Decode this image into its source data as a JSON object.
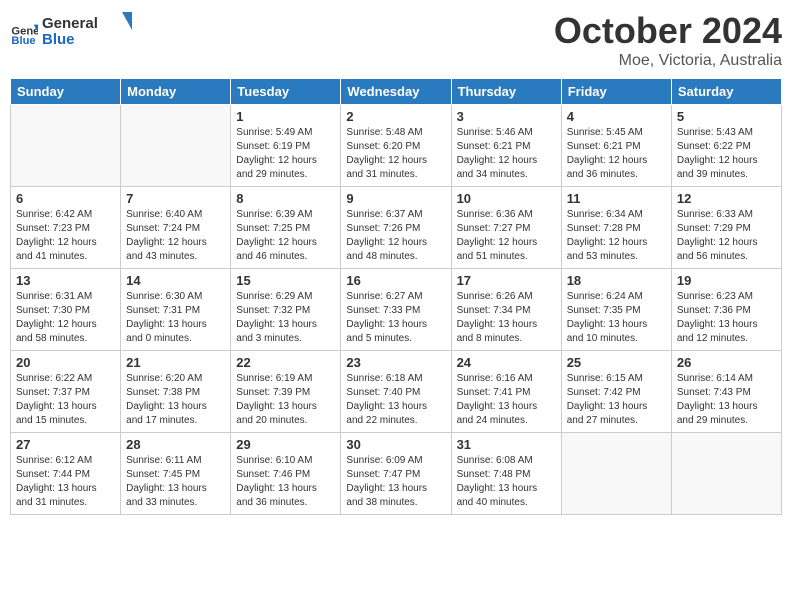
{
  "header": {
    "logo_line1": "General",
    "logo_line2": "Blue",
    "month_title": "October 2024",
    "subtitle": "Moe, Victoria, Australia"
  },
  "days_of_week": [
    "Sunday",
    "Monday",
    "Tuesday",
    "Wednesday",
    "Thursday",
    "Friday",
    "Saturday"
  ],
  "weeks": [
    [
      {
        "day": "",
        "info": ""
      },
      {
        "day": "",
        "info": ""
      },
      {
        "day": "1",
        "info": "Sunrise: 5:49 AM\nSunset: 6:19 PM\nDaylight: 12 hours\nand 29 minutes."
      },
      {
        "day": "2",
        "info": "Sunrise: 5:48 AM\nSunset: 6:20 PM\nDaylight: 12 hours\nand 31 minutes."
      },
      {
        "day": "3",
        "info": "Sunrise: 5:46 AM\nSunset: 6:21 PM\nDaylight: 12 hours\nand 34 minutes."
      },
      {
        "day": "4",
        "info": "Sunrise: 5:45 AM\nSunset: 6:21 PM\nDaylight: 12 hours\nand 36 minutes."
      },
      {
        "day": "5",
        "info": "Sunrise: 5:43 AM\nSunset: 6:22 PM\nDaylight: 12 hours\nand 39 minutes."
      }
    ],
    [
      {
        "day": "6",
        "info": "Sunrise: 6:42 AM\nSunset: 7:23 PM\nDaylight: 12 hours\nand 41 minutes."
      },
      {
        "day": "7",
        "info": "Sunrise: 6:40 AM\nSunset: 7:24 PM\nDaylight: 12 hours\nand 43 minutes."
      },
      {
        "day": "8",
        "info": "Sunrise: 6:39 AM\nSunset: 7:25 PM\nDaylight: 12 hours\nand 46 minutes."
      },
      {
        "day": "9",
        "info": "Sunrise: 6:37 AM\nSunset: 7:26 PM\nDaylight: 12 hours\nand 48 minutes."
      },
      {
        "day": "10",
        "info": "Sunrise: 6:36 AM\nSunset: 7:27 PM\nDaylight: 12 hours\nand 51 minutes."
      },
      {
        "day": "11",
        "info": "Sunrise: 6:34 AM\nSunset: 7:28 PM\nDaylight: 12 hours\nand 53 minutes."
      },
      {
        "day": "12",
        "info": "Sunrise: 6:33 AM\nSunset: 7:29 PM\nDaylight: 12 hours\nand 56 minutes."
      }
    ],
    [
      {
        "day": "13",
        "info": "Sunrise: 6:31 AM\nSunset: 7:30 PM\nDaylight: 12 hours\nand 58 minutes."
      },
      {
        "day": "14",
        "info": "Sunrise: 6:30 AM\nSunset: 7:31 PM\nDaylight: 13 hours\nand 0 minutes."
      },
      {
        "day": "15",
        "info": "Sunrise: 6:29 AM\nSunset: 7:32 PM\nDaylight: 13 hours\nand 3 minutes."
      },
      {
        "day": "16",
        "info": "Sunrise: 6:27 AM\nSunset: 7:33 PM\nDaylight: 13 hours\nand 5 minutes."
      },
      {
        "day": "17",
        "info": "Sunrise: 6:26 AM\nSunset: 7:34 PM\nDaylight: 13 hours\nand 8 minutes."
      },
      {
        "day": "18",
        "info": "Sunrise: 6:24 AM\nSunset: 7:35 PM\nDaylight: 13 hours\nand 10 minutes."
      },
      {
        "day": "19",
        "info": "Sunrise: 6:23 AM\nSunset: 7:36 PM\nDaylight: 13 hours\nand 12 minutes."
      }
    ],
    [
      {
        "day": "20",
        "info": "Sunrise: 6:22 AM\nSunset: 7:37 PM\nDaylight: 13 hours\nand 15 minutes."
      },
      {
        "day": "21",
        "info": "Sunrise: 6:20 AM\nSunset: 7:38 PM\nDaylight: 13 hours\nand 17 minutes."
      },
      {
        "day": "22",
        "info": "Sunrise: 6:19 AM\nSunset: 7:39 PM\nDaylight: 13 hours\nand 20 minutes."
      },
      {
        "day": "23",
        "info": "Sunrise: 6:18 AM\nSunset: 7:40 PM\nDaylight: 13 hours\nand 22 minutes."
      },
      {
        "day": "24",
        "info": "Sunrise: 6:16 AM\nSunset: 7:41 PM\nDaylight: 13 hours\nand 24 minutes."
      },
      {
        "day": "25",
        "info": "Sunrise: 6:15 AM\nSunset: 7:42 PM\nDaylight: 13 hours\nand 27 minutes."
      },
      {
        "day": "26",
        "info": "Sunrise: 6:14 AM\nSunset: 7:43 PM\nDaylight: 13 hours\nand 29 minutes."
      }
    ],
    [
      {
        "day": "27",
        "info": "Sunrise: 6:12 AM\nSunset: 7:44 PM\nDaylight: 13 hours\nand 31 minutes."
      },
      {
        "day": "28",
        "info": "Sunrise: 6:11 AM\nSunset: 7:45 PM\nDaylight: 13 hours\nand 33 minutes."
      },
      {
        "day": "29",
        "info": "Sunrise: 6:10 AM\nSunset: 7:46 PM\nDaylight: 13 hours\nand 36 minutes."
      },
      {
        "day": "30",
        "info": "Sunrise: 6:09 AM\nSunset: 7:47 PM\nDaylight: 13 hours\nand 38 minutes."
      },
      {
        "day": "31",
        "info": "Sunrise: 6:08 AM\nSunset: 7:48 PM\nDaylight: 13 hours\nand 40 minutes."
      },
      {
        "day": "",
        "info": ""
      },
      {
        "day": "",
        "info": ""
      }
    ]
  ]
}
